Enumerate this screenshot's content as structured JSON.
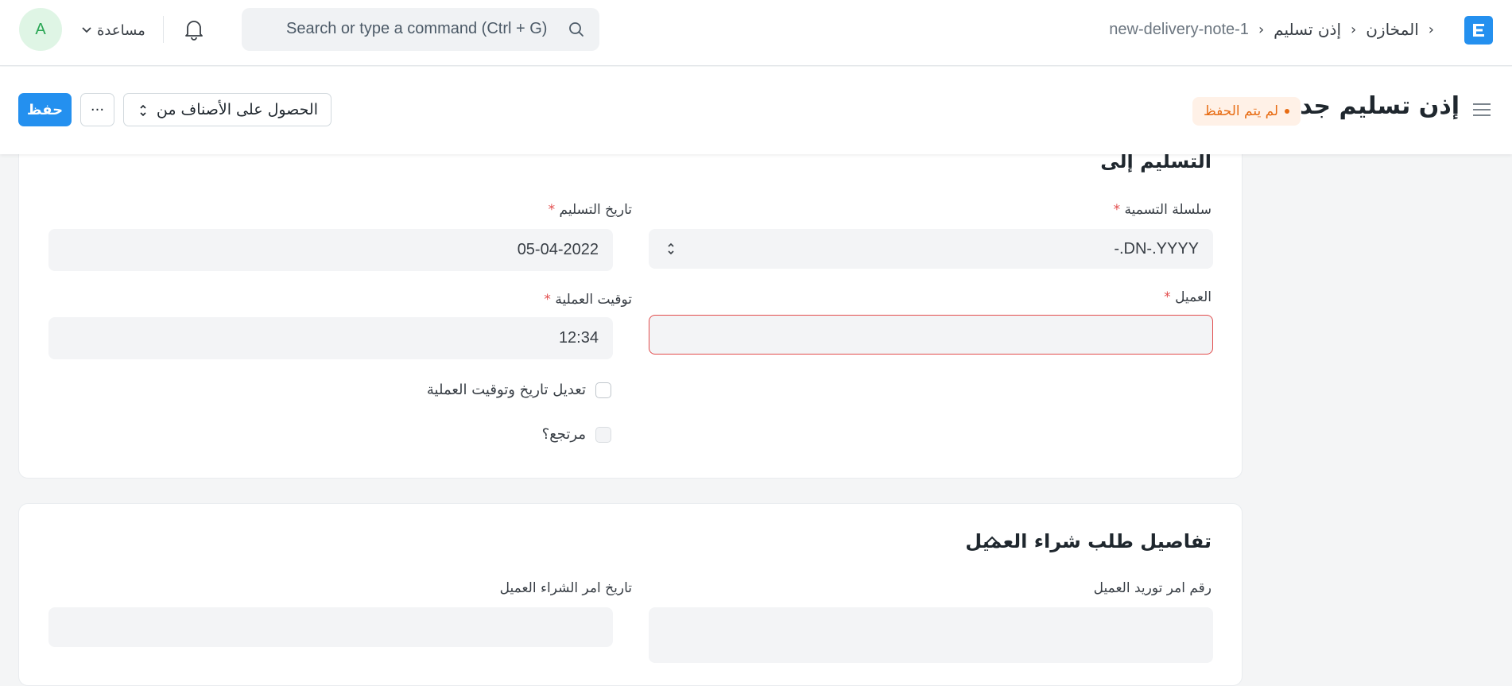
{
  "navbar": {
    "logo_letter": "E",
    "breadcrumb": [
      "المخازن",
      "إذن تسليم",
      "new-delivery-note-1"
    ],
    "search_placeholder": "Search or type a command (Ctrl + G)",
    "help_label": "مساعدة",
    "avatar_initial": "A"
  },
  "page_head": {
    "title": "إذن تسليم جديد",
    "status": "لم يتم الحفظ",
    "get_items_label": "الحصول على الأصناف من",
    "more_label": "···",
    "save_label": "حفظ"
  },
  "section_delivery": {
    "title": "التسليم إلى",
    "naming_series": {
      "label": "سلسلة التسمية",
      "required_mark": "*",
      "value": "-.DN-.YYYY"
    },
    "posting_date": {
      "label": "تاريخ التسليم",
      "required_mark": "*",
      "value": "05-04-2022"
    },
    "customer": {
      "label": "العميل",
      "required_mark": "*",
      "value": ""
    },
    "posting_time": {
      "label": "توقيت العملية",
      "required_mark": "*",
      "value": "12:34"
    },
    "edit_posting": {
      "label": "تعديل تاريخ وتوقيت العملية",
      "checked": false
    },
    "is_return": {
      "label": "مرتجع؟",
      "checked": false
    }
  },
  "section_po": {
    "title": "تفاصيل طلب شراء العميل",
    "po_no": {
      "label": "رقم امر توريد العميل",
      "value": ""
    },
    "po_date": {
      "label": "تاريخ امر الشراء العميل",
      "value": ""
    }
  },
  "colors": {
    "primary": "#2490ef",
    "status_orange": "#e86c13",
    "required_red": "#e24c4c",
    "avatar_green": "#29a654"
  }
}
